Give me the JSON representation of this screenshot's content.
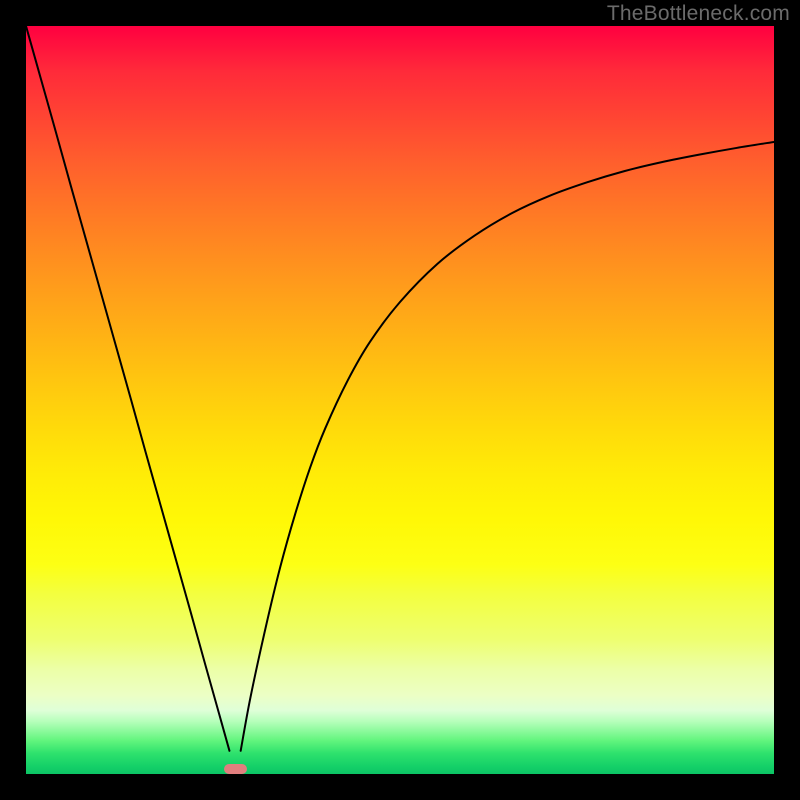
{
  "watermark": "TheBottleneck.com",
  "chart_data": {
    "type": "line",
    "title": "",
    "xlabel": "",
    "ylabel": "",
    "xlim": [
      0,
      100
    ],
    "ylim": [
      0,
      100
    ],
    "grid": false,
    "legend": false,
    "marker": {
      "x": 28,
      "width": 3,
      "height": 1.3,
      "color": "#e17e7e"
    },
    "series": [
      {
        "name": "left-branch",
        "x": [
          0,
          2,
          4,
          6,
          8,
          10,
          12,
          14,
          16,
          18,
          20,
          22,
          24,
          25.8,
          27.2
        ],
        "y": [
          100,
          92.9,
          85.8,
          78.6,
          71.5,
          64.4,
          57.3,
          50.2,
          43.0,
          35.9,
          28.8,
          21.7,
          14.5,
          8.1,
          3.1
        ]
      },
      {
        "name": "right-branch",
        "x": [
          28.7,
          30,
          32,
          34,
          36,
          38,
          40,
          43,
          46,
          50,
          55,
          60,
          65,
          70,
          75,
          80,
          85,
          90,
          95,
          100
        ],
        "y": [
          3.1,
          10.2,
          19.4,
          27.7,
          34.8,
          41.0,
          46.2,
          52.6,
          57.8,
          63.1,
          68.2,
          72.0,
          75.0,
          77.3,
          79.1,
          80.6,
          81.8,
          82.8,
          83.7,
          84.5
        ]
      }
    ],
    "gradient_stops": [
      {
        "pos": 0,
        "color": "#ff0040"
      },
      {
        "pos": 50,
        "color": "#ffc80f"
      },
      {
        "pos": 75,
        "color": "#fcff20"
      },
      {
        "pos": 100,
        "color": "#0cc465"
      }
    ]
  }
}
